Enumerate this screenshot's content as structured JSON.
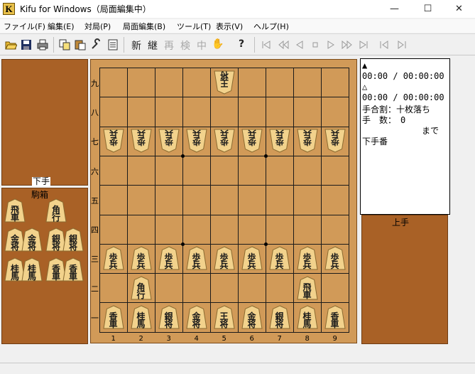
{
  "window": {
    "title": "Kifu for Windows（局面編集中）",
    "app_icon_letter": "K",
    "minimize": "—",
    "maximize": "☐",
    "close": "✕"
  },
  "menu": [
    "ファイル(F)",
    "編集(E)",
    "対局(P)",
    "局面編集(B)",
    "ツール(T)",
    "表示(V)",
    "ヘルプ(H)"
  ],
  "toolbar": {
    "new_text": "新",
    "continue_text": "継",
    "replay_text": "再",
    "review_text": "検",
    "interrupt_text": "中",
    "hand_icon": "✋",
    "help_icon": "?"
  },
  "board": {
    "col_labels": [
      "1",
      "2",
      "3",
      "4",
      "5",
      "6",
      "7",
      "8",
      "9"
    ],
    "row_labels": [
      "一",
      "二",
      "三",
      "四",
      "五",
      "六",
      "七",
      "八",
      "九"
    ]
  },
  "stands": {
    "top_label": "下手",
    "komabako_label": "駒箱",
    "bottom_label": "上手"
  },
  "info": {
    "sente_mark": "▲",
    "sente_time": "00:00 / 00:00:00",
    "gote_mark": "△",
    "gote_time": "00:00 / 00:00:00",
    "handicap": "手合割：十枚落ち",
    "moves": "手　数：　0",
    "until": "まで",
    "turn": "下手番"
  },
  "colors": {
    "board": "#d19a58",
    "stand": "#a96126",
    "piece_face": "#f2d28c"
  },
  "pieces": {
    "top": [
      {
        "c1": "王",
        "c2": "将",
        "gote": true
      }
    ],
    "gote_pawns": [
      "歩",
      "歩",
      "歩",
      "歩",
      "歩",
      "歩",
      "歩",
      "歩",
      "歩"
    ],
    "sente_pawns": [
      "歩",
      "歩",
      "歩",
      "歩",
      "歩",
      "歩",
      "歩",
      "歩",
      "歩"
    ],
    "sente_rook": {
      "c1": "飛",
      "c2": "車"
    },
    "sente_bishop": {
      "c1": "角",
      "c2": "行"
    },
    "back_rank": [
      {
        "c1": "香",
        "c2": "車"
      },
      {
        "c1": "桂",
        "c2": "馬"
      },
      {
        "c1": "銀",
        "c2": "将"
      },
      {
        "c1": "金",
        "c2": "将"
      },
      {
        "c1": "王",
        "c2": "将"
      },
      {
        "c1": "金",
        "c2": "将"
      },
      {
        "c1": "銀",
        "c2": "将"
      },
      {
        "c1": "桂",
        "c2": "馬"
      },
      {
        "c1": "香",
        "c2": "車"
      }
    ],
    "box": [
      {
        "c1": "飛",
        "c2": "車"
      },
      {
        "c1": "角",
        "c2": "行"
      },
      {
        "c1": "金",
        "c2": "将"
      },
      {
        "c1": "金",
        "c2": "将"
      },
      {
        "c1": "銀",
        "c2": "将"
      },
      {
        "c1": "銀",
        "c2": "将"
      },
      {
        "c1": "桂",
        "c2": "馬"
      },
      {
        "c1": "桂",
        "c2": "馬"
      },
      {
        "c1": "香",
        "c2": "車"
      },
      {
        "c1": "香",
        "c2": "車"
      }
    ]
  }
}
